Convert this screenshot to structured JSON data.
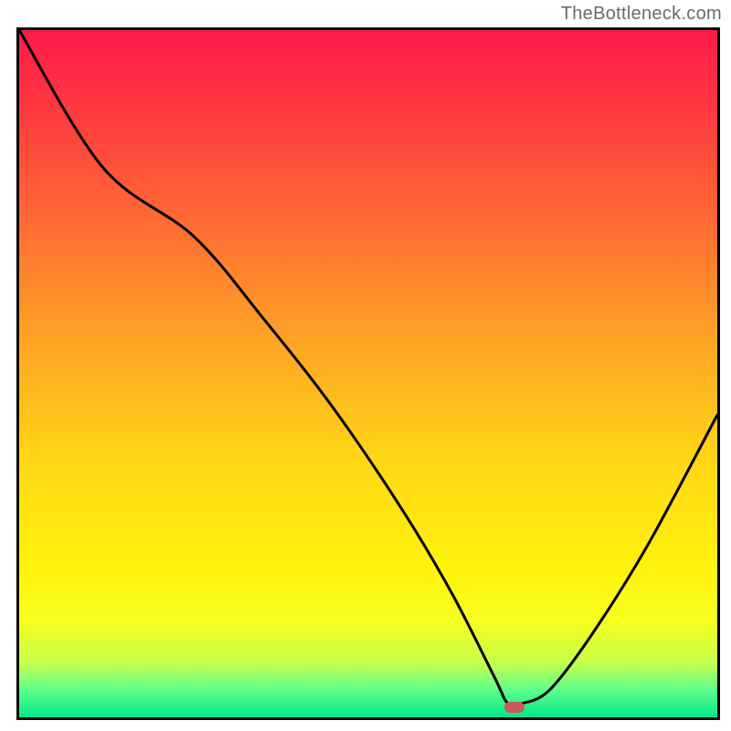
{
  "watermark": "TheBottleneck.com",
  "chart_data": {
    "type": "line",
    "title": "",
    "xlabel": "",
    "ylabel": "",
    "xlim": [
      0,
      100
    ],
    "ylim": [
      0,
      100
    ],
    "series": [
      {
        "name": "curve",
        "x": [
          0,
          12,
          25,
          35,
          45,
          55,
          62,
          68,
          70,
          72,
          76,
          82,
          90,
          100
        ],
        "y": [
          100,
          80,
          70,
          58,
          45,
          30,
          18,
          6,
          2,
          2,
          4,
          12,
          25,
          44
        ]
      }
    ],
    "marker": {
      "x": 71,
      "y": 1.5,
      "color": "#c85a5a"
    },
    "gradient_stops": [
      {
        "pct": 0,
        "color": "#ff1a4b"
      },
      {
        "pct": 12,
        "color": "#ff3a3f"
      },
      {
        "pct": 28,
        "color": "#ff6b34"
      },
      {
        "pct": 45,
        "color": "#ffa325"
      },
      {
        "pct": 62,
        "color": "#ffd516"
      },
      {
        "pct": 78,
        "color": "#fff20c"
      },
      {
        "pct": 86,
        "color": "#f7ff1f"
      },
      {
        "pct": 92,
        "color": "#c6ff4a"
      },
      {
        "pct": 96,
        "color": "#5fff8a"
      },
      {
        "pct": 100,
        "color": "#00e88a"
      }
    ]
  }
}
